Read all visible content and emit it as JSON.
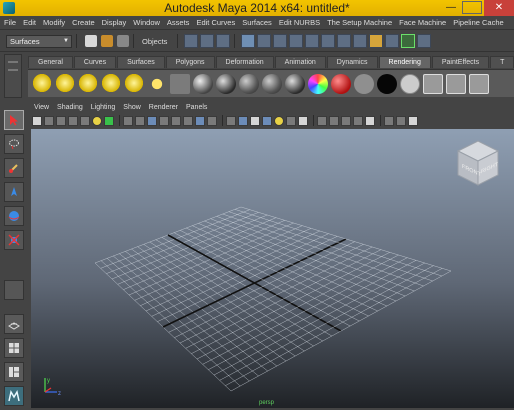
{
  "window": {
    "title": "Autodesk Maya 2014 x64: untitled*",
    "minimize": "—",
    "maximize": "",
    "close": "✕"
  },
  "menubar": [
    "File",
    "Edit",
    "Modify",
    "Create",
    "Display",
    "Window",
    "Assets",
    "Edit Curves",
    "Surfaces",
    "Edit NURBS",
    "The Setup Machine",
    "Face Machine",
    "Pipeline Cache"
  ],
  "statusline": {
    "mode": "Surfaces",
    "objects_label": "Objects"
  },
  "shelf": {
    "tabs": [
      "General",
      "Curves",
      "Surfaces",
      "Polygons",
      "Deformation",
      "Animation",
      "Dynamics",
      "Rendering",
      "PaintEffects"
    ],
    "active_tab": "Rendering",
    "more": "T"
  },
  "panel": {
    "menu": [
      "View",
      "Shading",
      "Lighting",
      "Show",
      "Renderer",
      "Panels"
    ]
  },
  "viewcube": {
    "front": "FRONT",
    "right": "RIGHT"
  },
  "viewport": {
    "camera_label": "persp",
    "axis_y": "y",
    "axis_z": "z"
  },
  "colors": {
    "titlebar": "#f3c400",
    "close_button": "#c8413a",
    "ui_background": "#444444",
    "viewport_top": "#8f9fb3",
    "viewport_bottom": "#1f2226"
  }
}
